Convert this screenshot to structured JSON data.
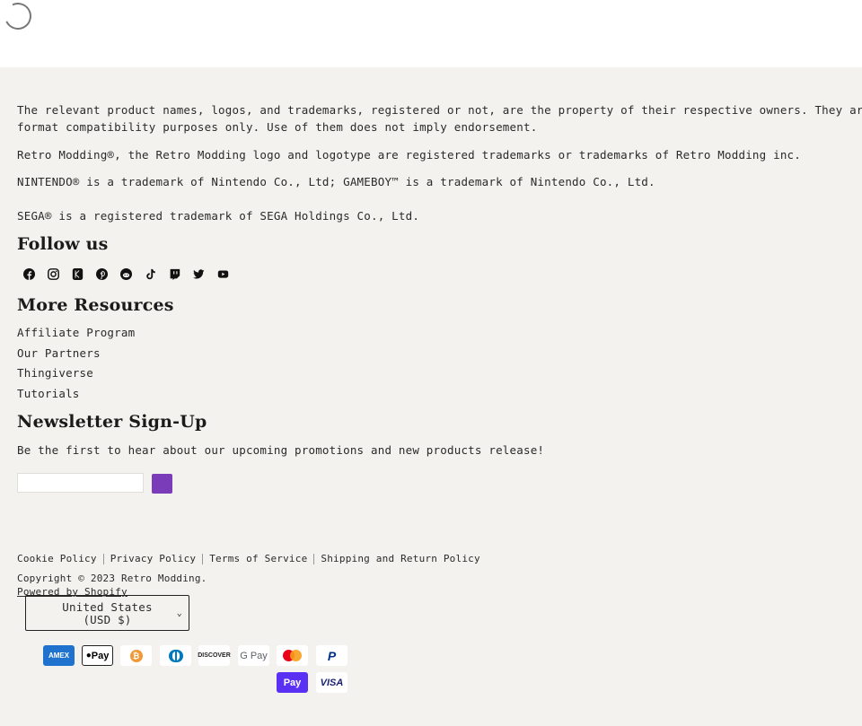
{
  "footer": {
    "disclaimer_line1": "The relevant product names, logos, and trademarks, registered or not, are the property of their respective owners. They are used for",
    "disclaimer_line2": "format compatibility purposes only. Use of them does not imply endorsement.",
    "trademark_retro": "Retro Modding®, the Retro Modding logo and logotype are registered trademarks or trademarks of Retro Modding inc.",
    "trademark_nintendo": "NINTENDO® is a trademark of Nintendo Co., Ltd; GAMEBOY™ is a trademark of Nintendo Co., Ltd.",
    "trademark_sega": "SEGA® is a registered trademark of SEGA Holdings Co., Ltd.",
    "follow_heading": "Follow us",
    "social": [
      "facebook",
      "instagram",
      "kickstarter",
      "pinterest",
      "reddit",
      "tiktok",
      "twitch",
      "twitter",
      "youtube"
    ],
    "resources_heading": "More Resources",
    "resources": [
      "Affiliate Program",
      "Our Partners",
      "Thingiverse",
      "Tutorials"
    ],
    "newsletter_heading": "Newsletter Sign-Up",
    "newsletter_text": "Be the first to hear about our upcoming promotions and new products release!",
    "newsletter_input_value": "",
    "newsletter_button_color": "#7a3cb8",
    "policies": [
      "Cookie Policy",
      "Privacy Policy",
      "Terms of Service",
      "Shipping and Return Policy"
    ],
    "copyright": "Copyright © 2023 Retro Modding.",
    "powered_by": "Powered by Shopify",
    "country_line1": "United States",
    "country_line2": "(USD $)",
    "payment_methods": [
      "AMEX",
      "Apple Pay",
      "Bitcoin",
      "Diners Club",
      "Discover",
      "Google Pay",
      "Mastercard",
      "PayPal",
      "Shop Pay",
      "Visa"
    ],
    "payment_labels": {
      "amex": "AMEX",
      "applepay": " Pay",
      "discover": "DISCOVER",
      "gpay": "G Pay",
      "shoppay": "Pay",
      "visa": "VISA"
    }
  }
}
